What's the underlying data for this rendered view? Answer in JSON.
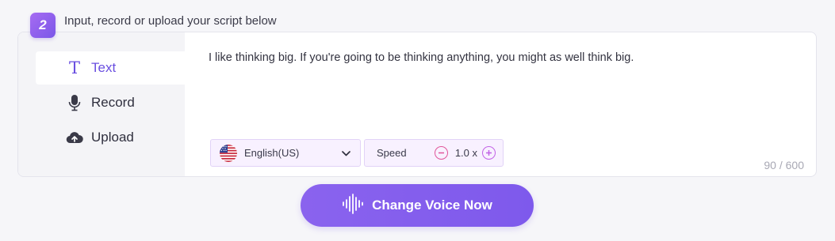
{
  "step": {
    "number": "2",
    "title": "Input, record or upload your script below"
  },
  "sidebar": {
    "items": [
      {
        "label": "Text",
        "icon": "text-icon",
        "active": true
      },
      {
        "label": "Record",
        "icon": "microphone-icon",
        "active": false
      },
      {
        "label": "Upload",
        "icon": "cloud-upload-icon",
        "active": false
      }
    ]
  },
  "script": {
    "text": "I like thinking big. If you're going to be thinking anything, you might as well think big."
  },
  "language": {
    "selected": "English(US)",
    "icon": "us-flag-icon"
  },
  "speed": {
    "label": "Speed",
    "value": "1.0 x"
  },
  "counter": "90 / 600",
  "cta": {
    "label": "Change Voice Now",
    "icon": "waveform-icon"
  },
  "colors": {
    "accent": "#7e59ec",
    "badge": "#8e62ee",
    "minus": "#e0559a",
    "plus": "#c262e6"
  }
}
